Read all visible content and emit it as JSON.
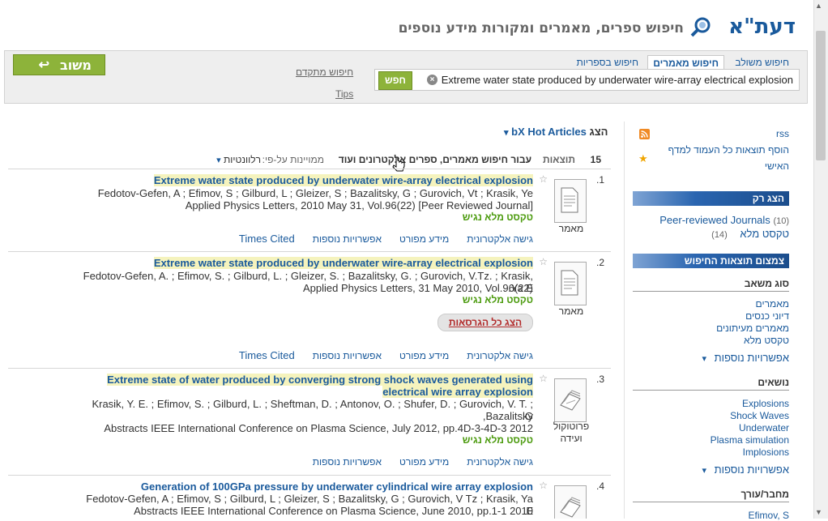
{
  "header": {
    "logo_text": "דעת\"א",
    "subtitle": "חיפוש ספרים, מאמרים ומקורות מידע נוספים"
  },
  "search": {
    "tabs": [
      "חיפוש משולב",
      "חיפוש מאמרים",
      "חיפוש בספריות"
    ],
    "active_tab_index": 1,
    "query": "Extreme water state produced by underwater wire-array electrical explosion",
    "go_label": "חפש",
    "advanced_label": "חיפוש מתקדם",
    "tips_label": "Tips",
    "back_label": "משוב"
  },
  "results_header": {
    "bx_prefix": "הצג",
    "bx_label": "bX Hot Articles",
    "count": "15",
    "count_label": "תוצאות",
    "scope_label": "עבור חיפוש מאמרים, ספרים אלקטרונים ועוד",
    "sort_prefix": "ממויינות על-פי:",
    "sort_value": "רלוונטיות"
  },
  "results": [
    {
      "num": "1.",
      "type": "מאמר",
      "title_parts": [
        "Extreme water state produced by underwater wire-array electrical explosion"
      ],
      "authors": "Fedotov-Gefen, A ; Efimov, S ; Gilburd, L ; Gleizer, S ; Bazalitsky, G ; Gurovich, Vt ; Krasik, Ye",
      "source": "[Applied Physics Letters, 2010 May 31, Vol.96(22) [Peer Reviewed Journal",
      "fulltext": "טקסט מלא נגיש",
      "actions": [
        "גישה אלקטרונית",
        "מידע מפורט",
        "אפשרויות נוספות",
        "Times Cited"
      ]
    },
    {
      "num": "2.",
      "type": "מאמר",
      "title_parts": [
        "Extreme water state produced by underwater wire-array electrical explosion"
      ],
      "authors": "Fedotov-Gefen, A. ; Efimov, S. ; Gilburd, L. ; Gleizer, S. ; Bazalitsky, G. ; Gurovich, V.Tz. ; Krasik, Ya.E.",
      "source": "Applied Physics Letters, 31 May 2010, Vol.96(22)",
      "fulltext": "טקסט מלא נגיש",
      "versions_label": "הצג כל הגרסאות",
      "actions": [
        "גישה אלקטרונית",
        "מידע מפורט",
        "אפשרויות נוספות",
        "Times Cited"
      ]
    },
    {
      "num": "3.",
      "type": "פרוטוקול ועידה",
      "title_line1": "Extreme state of water produced by converging strong shock waves generated using underwater",
      "title_line2": "electrical wire array explosion",
      "authors_line1": "Krasik, Y. E. ; Efimov, S. ; Gilburd, L. ; Sheftman, D. ; Antonov, O. ; Shufer, D. ; Gurovich, V. T. ; Bazalitsky,",
      "authors_line2": "G.",
      "source": "Abstracts IEEE International Conference on Plasma Science, July 2012, pp.4D-3-4D-3 2012",
      "fulltext": "טקסט מלא נגיש",
      "actions": [
        "גישה אלקטרונית",
        "מידע מפורט",
        "אפשרויות נוספות"
      ]
    },
    {
      "num": "4.",
      "title": "Generation of 100GPa pressure by underwater cylindrical wire array explosion",
      "authors": "Fedotov-Gefen, A ; Efimov, S ; Gilburd, L ; Gleizer, S ; Bazalitsky, G ; Gurovich, V Tz ; Krasik, Ya E",
      "source": "Abstracts IEEE International Conference on Plasma Science, June 2010, pp.1-1 2010"
    }
  ],
  "sidebar": {
    "rss_label": "rss",
    "add_label_line1": "הוסף תוצאות כל העמוד למדף",
    "add_label_line2": "האישי",
    "show_only_head": "הצג רק",
    "show_only": [
      {
        "label": "Peer-reviewed Journals",
        "count": "(10)"
      },
      {
        "label": "טקסט מלא",
        "count": "(14)"
      }
    ],
    "narrow_head": "צמצום תוצאות החיפוש",
    "resource_type_head": "סוג משאב",
    "resource_types": [
      "מאמרים",
      "דיוני כנסים",
      "מאמרים מעיתונים",
      "טקסט מלא"
    ],
    "more_options": "אפשרויות נוספות",
    "topics_head": "נושאים",
    "topics": [
      "Explosions",
      "Shock Waves",
      "Underwater",
      "Plasma simulation",
      "Implosions"
    ],
    "author_head": "מחבר/עורך",
    "authors": [
      "Efimov, S"
    ]
  }
}
